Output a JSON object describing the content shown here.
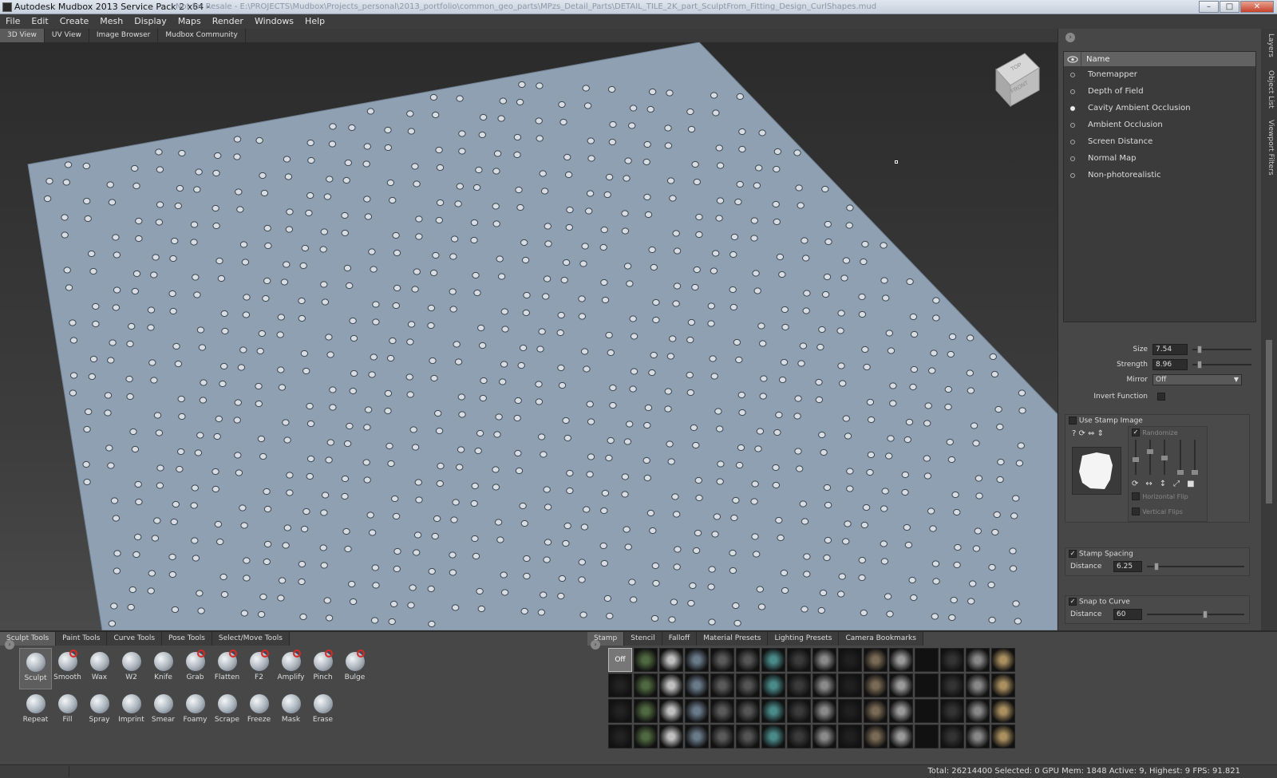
{
  "window": {
    "title": "Autodesk Mudbox 2013 Service Pack 2 x64 -",
    "path": "Not for Resale - E:\\PROJECTS\\Mudbox\\Projects_personal\\2013_portfolio\\common_geo_parts\\MPzs_Detail_Parts\\DETAIL_TILE_2K_part_SculptFrom_Fitting_Design_CurlShapes.mud",
    "buttons": [
      "–",
      "□",
      "✕"
    ]
  },
  "menubar": [
    "File",
    "Edit",
    "Create",
    "Mesh",
    "Display",
    "Maps",
    "Render",
    "Windows",
    "Help"
  ],
  "view_tabs": [
    {
      "label": "3D View",
      "active": true
    },
    {
      "label": "UV View",
      "active": false
    },
    {
      "label": "Image Browser",
      "active": false
    },
    {
      "label": "Mudbox Community",
      "active": false
    }
  ],
  "viewcube": {
    "top": "TOP",
    "front": "FRONT"
  },
  "right_panel": {
    "header_name": "Name",
    "filters": [
      {
        "label": "Tonemapper",
        "on": false
      },
      {
        "label": "Depth of Field",
        "on": false
      },
      {
        "label": "Cavity Ambient Occlusion",
        "on": true
      },
      {
        "label": "Ambient Occlusion",
        "on": false
      },
      {
        "label": "Screen Distance",
        "on": false
      },
      {
        "label": "Normal Map",
        "on": false
      },
      {
        "label": "Non-photorealistic",
        "on": false
      }
    ],
    "vertical_tabs": [
      "Layers",
      "Object List",
      "Viewport Filters"
    ]
  },
  "properties": {
    "size": {
      "label": "Size",
      "value": "7.54",
      "slider": 0.08
    },
    "strength": {
      "label": "Strength",
      "value": "8.96",
      "slider": 0.09
    },
    "mirror": {
      "label": "Mirror",
      "value": "Off"
    },
    "invert_label": "Invert Function",
    "use_stamp_label": "Use Stamp Image",
    "stamp_tool_icons": "? ⟳ ⇔ ⇕",
    "randomize_label": "Randomize",
    "horizontal_flip_label": "Horizontal Flip",
    "vertical_flips_label": "Vertical Flips",
    "stamp_spacing_label": "Stamp Spacing",
    "stamp_spacing_distance_label": "Distance",
    "stamp_spacing_value": "6.25",
    "stamp_spacing_slider": 0.08,
    "snap_label": "Snap to Curve",
    "snap_distance_label": "Distance",
    "snap_value": "60",
    "snap_slider": 0.6
  },
  "tool_tabs": [
    {
      "label": "Sculpt Tools",
      "active": true
    },
    {
      "label": "Paint Tools",
      "active": false
    },
    {
      "label": "Curve Tools",
      "active": false
    },
    {
      "label": "Pose Tools",
      "active": false
    },
    {
      "label": "Select/Move Tools",
      "active": false
    }
  ],
  "tools_row1": [
    "Sculpt",
    "Smooth",
    "Wax",
    "W2",
    "Knife",
    "Grab",
    "Flatten",
    "F2",
    "Amplify",
    "Pinch",
    "Bulge"
  ],
  "tools_row2": [
    "Repeat",
    "Fill",
    "Spray",
    "Imprint",
    "Smear",
    "Foamy",
    "Scrape",
    "Freeze",
    "Mask",
    "Erase"
  ],
  "tray_tabs": [
    {
      "label": "Stamp",
      "active": true
    },
    {
      "label": "Stencil",
      "active": false
    },
    {
      "label": "Falloff",
      "active": false
    },
    {
      "label": "Material Presets",
      "active": false
    },
    {
      "label": "Lighting Presets",
      "active": false
    },
    {
      "label": "Camera Bookmarks",
      "active": false
    }
  ],
  "stamp_off_label": "Off",
  "status": "Total: 26214400  Selected: 0 GPU Mem: 1848  Active: 9, Highest: 9  FPS: 91.821"
}
